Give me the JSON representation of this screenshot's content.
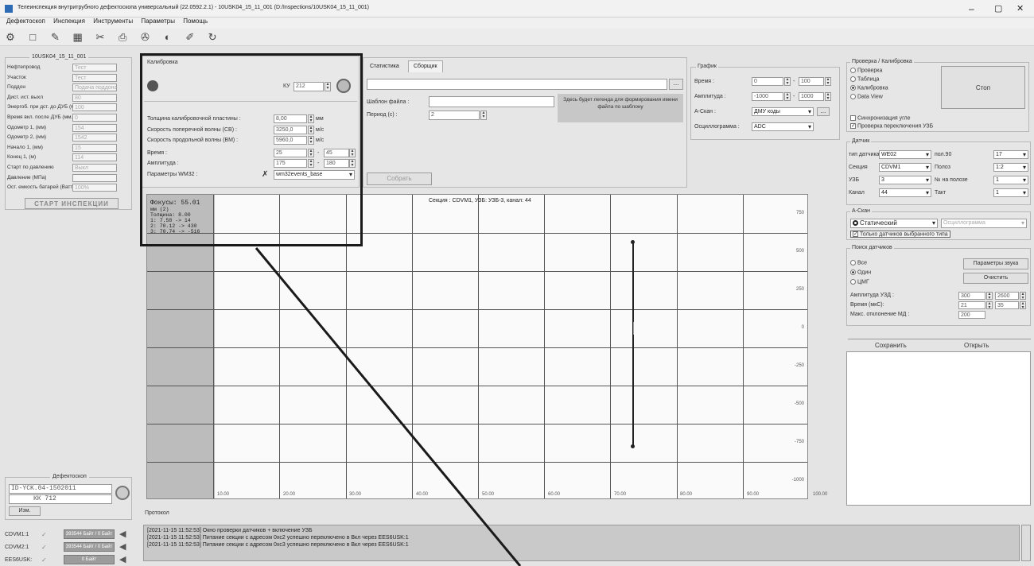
{
  "title": "Телеинспекция внутритрубного дефектоскопа универсальный (22.0592.2.1) - 10USK04_15_11_001 (D:/Inspections/10USK04_15_11_001)",
  "window_controls": {
    "min": "–",
    "max": "▢",
    "close": "✕"
  },
  "menu": [
    "Дефектоскоп",
    "Инспекция",
    "Инструменты",
    "Параметры",
    "Помощь"
  ],
  "left": {
    "group_title": "10USK04_15_11_001",
    "fields": [
      {
        "label": "Нефтепровод",
        "value": "Тест"
      },
      {
        "label": "Участок",
        "value": "Тест"
      },
      {
        "label": "Поддон",
        "value": "Подача поддона"
      },
      {
        "label": "Дист. ист. выхл",
        "value": "80"
      },
      {
        "label": "Энергоб. при дст. до ДУБ (мм.)",
        "value": "100"
      },
      {
        "label": "Время вкл. после ДУБ (мм.) :",
        "value": "0"
      },
      {
        "label": "Одометр 1, (мм)",
        "value": "154"
      },
      {
        "label": "Одометр 2, (мм)",
        "value": "1542"
      },
      {
        "label": "Начало 1, (мм)",
        "value": "15"
      },
      {
        "label": "Конец 1, (м)",
        "value": "114"
      },
      {
        "label": "Старт по давлению",
        "value": "Выкл"
      },
      {
        "label": "Давление (МПа)",
        "value": ""
      },
      {
        "label": "Ост. емкость батарей (Ватт*ч)",
        "value": "100%"
      }
    ],
    "start_button": "СТАРТ ИНСПЕКЦИИ",
    "defect_group": "Дефектоскоп",
    "defect_line1": "ID-YCK.04-1502011",
    "defect_line2": "КК 712",
    "defect_btn": "Изм.",
    "channels": [
      {
        "label": "CDVM1:1",
        "value": "393544 Байт / 0 Байт"
      },
      {
        "label": "CDVM2:1",
        "value": "393544 Байт / 0 Байт"
      },
      {
        "label": "EES6USK:",
        "value": "0 Байт"
      }
    ]
  },
  "calib": {
    "title": "Калибровка",
    "ku_label": "КУ",
    "ku_value": "212",
    "rows": [
      {
        "label": "Толщина калибровочной пластины :",
        "value": "8,00",
        "unit": "мм"
      },
      {
        "label": "Скорость поперечной волны (СВ) :",
        "value": "3250,0",
        "unit": "м/с"
      },
      {
        "label": "Скорость продольной волны (ВМ) :",
        "value": "5960,0",
        "unit": "м/с"
      }
    ],
    "time_label": "Время :",
    "time_from": "25",
    "time_to": "45",
    "amp_label": "Амплитуда :",
    "amp_from": "175",
    "amp_to": "180",
    "params_label": "Параметры WM32 :",
    "params_value": "wm32events_base"
  },
  "tabs": {
    "items": [
      "Статистика",
      "Сборщик"
    ],
    "active": 1
  },
  "collector": {
    "file_tmpl_label": "Шаблон файла :",
    "period_label": "Период (с) :",
    "period_value": "2",
    "hint": "Здесь будет легенда для формирования имени файла по шаблону",
    "collect_btn": "Собрать"
  },
  "graph": {
    "title": "График",
    "time_label": "Время :",
    "time_from": "0",
    "time_to": "100",
    "amp_label": "Амплитуда :",
    "amp_from": "-1000",
    "amp_to": "1000",
    "ascan_label": "A-Скан :",
    "ascan_value": "ДМУ коды",
    "osc_label": "Осциллограмма :",
    "osc_value": "ADC"
  },
  "check": {
    "title": "Проверка / Калибровка",
    "options": [
      "Проверка",
      "Таблица",
      "Калибровка",
      "Data View"
    ],
    "selected": 2,
    "stop_btn": "Стоп",
    "sync_label": "Синхронизация угле",
    "switch_label": "Проверка переключения УЗБ"
  },
  "sensors": {
    "title": "Датчик",
    "rows": [
      {
        "l1": "тип датчика",
        "v1": "WE02",
        "l2": "пол.90",
        "v2": "17"
      },
      {
        "l1": "Секция",
        "v1": "CDVM1",
        "l2": "Полоз",
        "v2": "1:2"
      },
      {
        "l1": "УЗБ",
        "v1": "3",
        "l2": "№ на полозе",
        "v2": "1"
      },
      {
        "l1": "Канал",
        "v1": "44",
        "l2": "Такт",
        "v2": "1"
      }
    ]
  },
  "ascan": {
    "title": "A-Скан",
    "mode": "Статический",
    "osc": "Осциллограмма",
    "only_selected": "Только датчиков выбранного типа"
  },
  "search": {
    "title": "Поиск датчиков",
    "options": [
      "Все",
      "Один",
      "ЦМГ"
    ],
    "selected": 1,
    "sound_btn": "Параметры звука",
    "clear_btn": "Очистить",
    "rows": [
      {
        "label": "Амплитуда УЗД :",
        "v1": "300",
        "v2": "2600"
      },
      {
        "label": "Время (мкС):",
        "v1": "21",
        "v2": "35"
      },
      {
        "label": "Макс. отклонение МД :",
        "v1": "200",
        "v2": ""
      }
    ],
    "save_btn": "Сохранить",
    "open_btn": "Открыть"
  },
  "chart": {
    "header": "Секция : CDVM1, УЗБ: УЗБ-3, канал: 44",
    "info_lines": [
      "Фокусы: 55.01",
      "мм (2)",
      "Толщина: 8.00",
      "1: 7.58 -> 14",
      "2: 70.12 -> 430",
      "3: 70.74 -> -516"
    ],
    "yticks": [
      "750",
      "500",
      "250",
      "0",
      "-250",
      "-500",
      "-750",
      "-1000"
    ],
    "xticks": [
      "10.00",
      "20.00",
      "30.00",
      "40.00",
      "50.00",
      "60.00",
      "70.00",
      "80.00",
      "90.00",
      "100.00"
    ]
  },
  "protocol": {
    "title": "Протокол",
    "lines": [
      "[2021-11-15 11:52:53] Окно проверки датчиков + включение УЗБ",
      "[2021-11-15 11:52:53] Питание секции с адресом 0xc2 успешно переключено в Вкл через EES6USK:1",
      "[2021-11-15 11:52:53] Питание секции с адресом 0xc3 успешно переключено в Вкл через EES6USK:1"
    ]
  }
}
